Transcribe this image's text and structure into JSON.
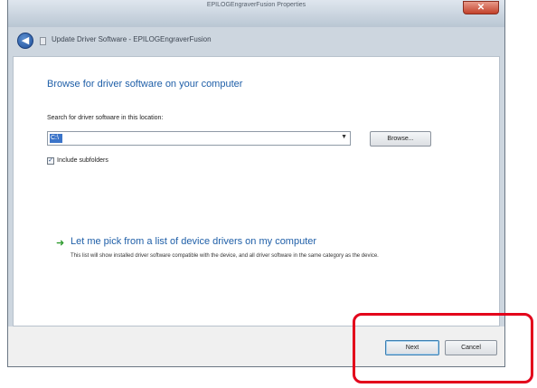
{
  "window": {
    "title": "EPILOGEngraverFusion Properties",
    "close_label": "✕"
  },
  "nav": {
    "back_icon": "back-arrow-icon",
    "title": "Update Driver Software - EPILOGEngraverFusion"
  },
  "content": {
    "heading": "Browse for driver software on your computer",
    "search_label": "Search for driver software in this location:",
    "path_value": "C:\\",
    "browse_label": "Browse...",
    "include_subfolders_label": "Include subfolders",
    "include_subfolders_checked": true,
    "pick_link": "Let me pick from a list of device drivers on my computer",
    "pick_description": "This list will show installed driver software compatible with the device, and all driver software in the same category as the device."
  },
  "footer": {
    "next_label": "Next",
    "cancel_label": "Cancel"
  },
  "colors": {
    "heading": "#1f5fa8",
    "link_arrow": "#2e9b2e",
    "highlight": "#e3001b"
  }
}
